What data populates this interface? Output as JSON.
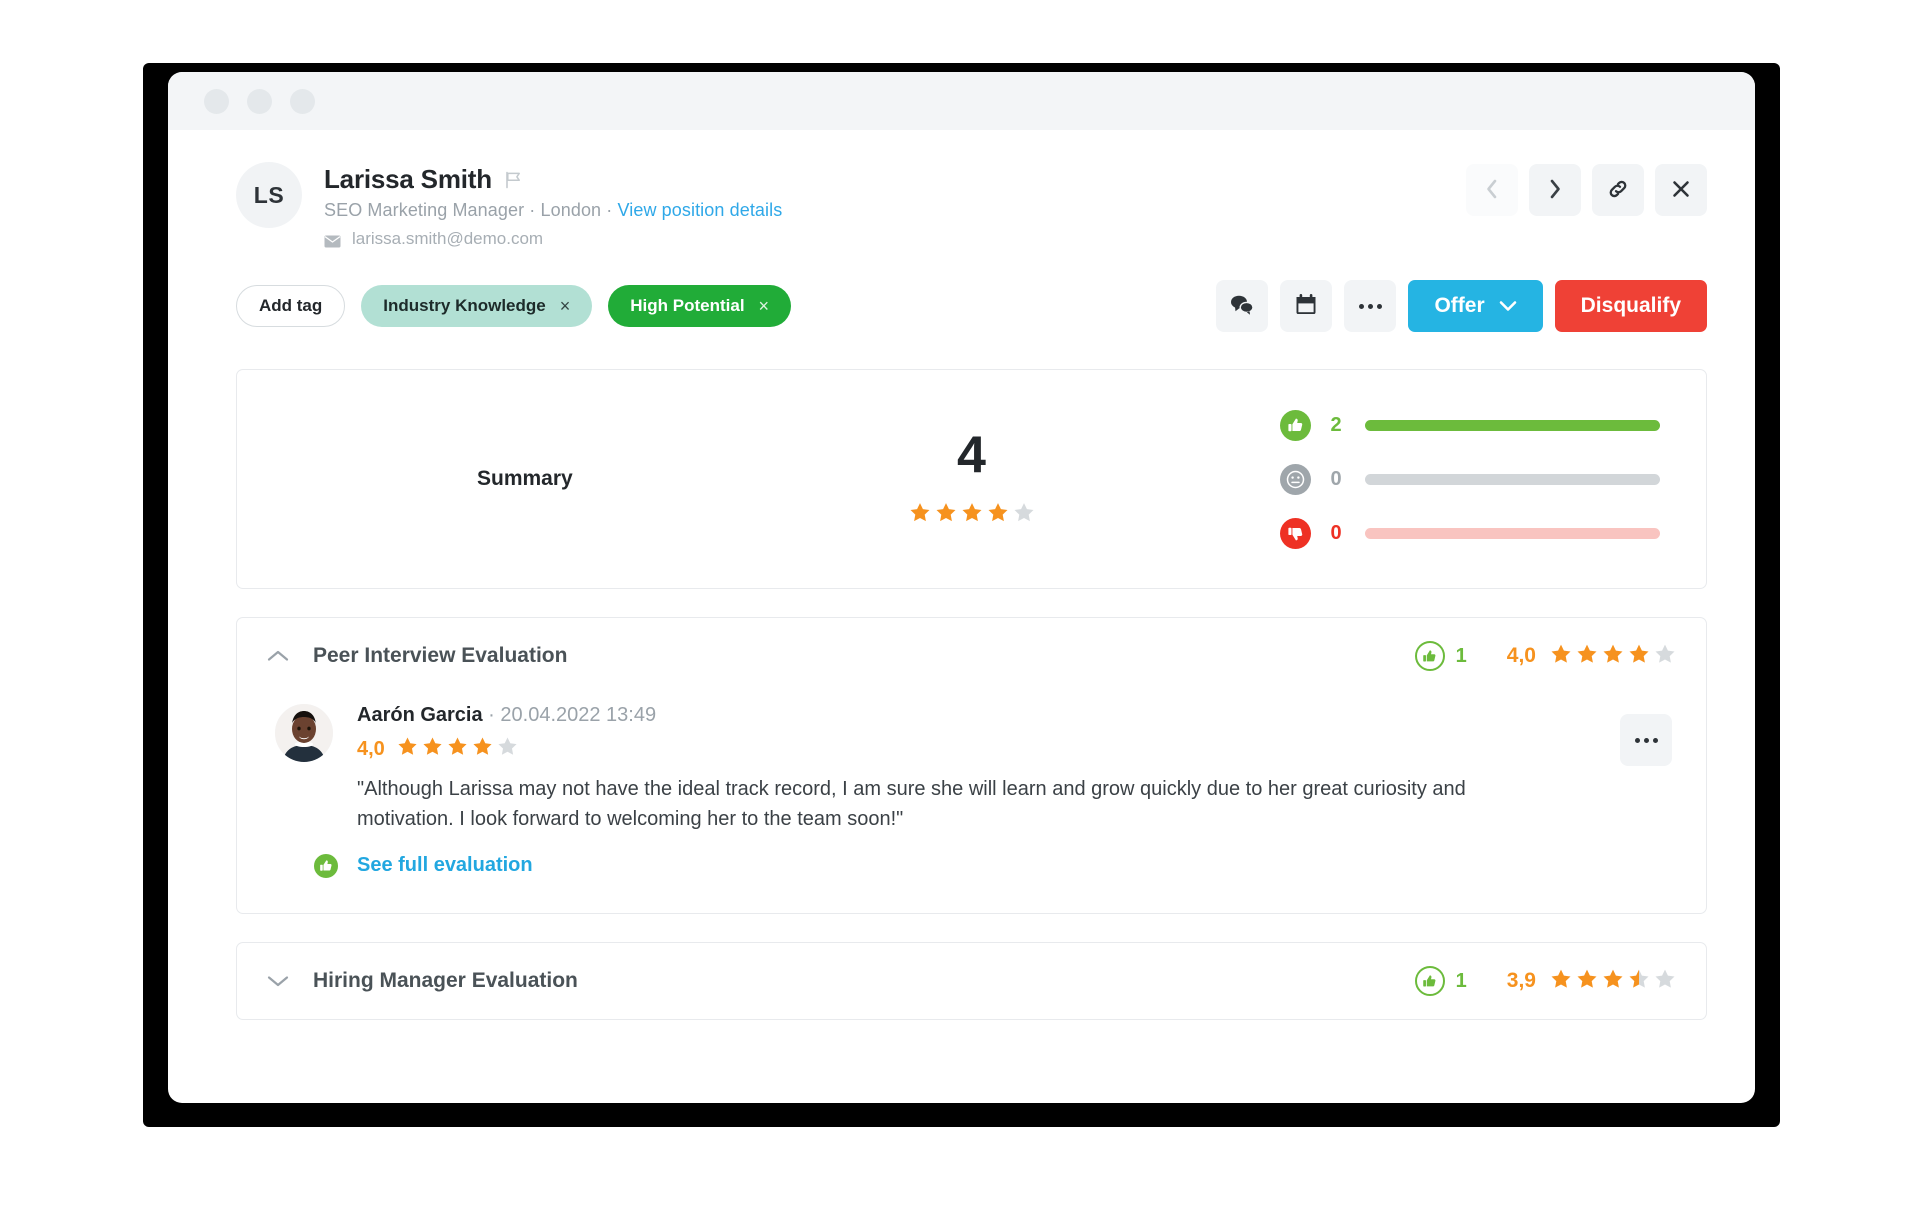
{
  "window": {
    "dots": [
      "dot-1",
      "dot-2",
      "dot-3"
    ]
  },
  "candidate": {
    "initials": "LS",
    "name": "Larissa Smith",
    "flag_icon": "flag-icon",
    "position": "SEO Marketing Manager",
    "separator": " · ",
    "location": "London",
    "position_link": "View position details",
    "mail_icon": "envelope-icon",
    "email": "larissa.smith@demo.com"
  },
  "header_actions": [
    {
      "name": "prev-candidate-button",
      "icon": "chevron-left-icon"
    },
    {
      "name": "next-candidate-button",
      "icon": "chevron-right-icon"
    },
    {
      "name": "copy-link-button",
      "icon": "link-icon"
    },
    {
      "name": "close-button",
      "icon": "close-icon"
    }
  ],
  "tags": {
    "add_label": "Add tag",
    "items": [
      {
        "label": "Industry Knowledge",
        "color": "#b2e0d4",
        "text_color": "#1d2b2a",
        "remove": "×"
      },
      {
        "label": "High Potential",
        "color": "#21ac38",
        "text_color": "#ffffff",
        "remove": "×"
      }
    ]
  },
  "toolbar": {
    "comment_icon": "comments-icon",
    "calendar_icon": "calendar-icon",
    "more_icon": "ellipsis-icon",
    "offer_label": "Offer",
    "offer_caret": "chevron-down-icon",
    "offer_color": "#25b4e3",
    "disqualify_label": "Disqualify",
    "disqualify_color": "#ef4136"
  },
  "summary": {
    "label": "Summary",
    "score": "4",
    "stars_filled": 4,
    "stars_total": 5,
    "star_color": "#f6921e",
    "star_empty_color": "#d6dadd",
    "ratings": [
      {
        "icon": "thumbs-up-icon",
        "count": "2",
        "color": "#6cbb3c",
        "track_color": "#6cbb3c",
        "fill": 100
      },
      {
        "icon": "neutral-face-icon",
        "count": "0",
        "color": "#9fa6ab",
        "track_color": "#d2d6d9",
        "fill": 100
      },
      {
        "icon": "thumbs-down-icon",
        "count": "0",
        "color": "#ee3124",
        "track_color": "#f9c4c0",
        "fill": 100
      }
    ]
  },
  "evaluations": [
    {
      "expanded": true,
      "chevron": "chevron-up-icon",
      "title": "Peer Interview Evaluation",
      "thumb_icon": "thumbs-up-icon",
      "thumb_count": "1",
      "score": "4,0",
      "stars_filled": 4,
      "stars_half": 0,
      "stars_total": 5,
      "review": {
        "avatar": "reviewer-photo",
        "thumb_icon": "thumbs-up-icon",
        "author": "Aarón Garcia",
        "timestamp_sep": " · ",
        "timestamp": "20.04.2022 13:49",
        "score": "4,0",
        "stars_filled": 4,
        "stars_half": 0,
        "stars_total": 5,
        "quote": "\"Although Larissa may not have the ideal track record, I am sure she will learn and grow quickly due to her great curiosity and motivation. I look forward to welcoming her to the team soon!\"",
        "link_label": "See full evaluation",
        "more_icon": "ellipsis-icon"
      }
    },
    {
      "expanded": false,
      "chevron": "chevron-down-icon",
      "title": "Hiring Manager Evaluation",
      "thumb_icon": "thumbs-up-icon",
      "thumb_count": "1",
      "score": "3,9",
      "stars_filled": 3,
      "stars_half": 1,
      "stars_total": 5
    }
  ]
}
